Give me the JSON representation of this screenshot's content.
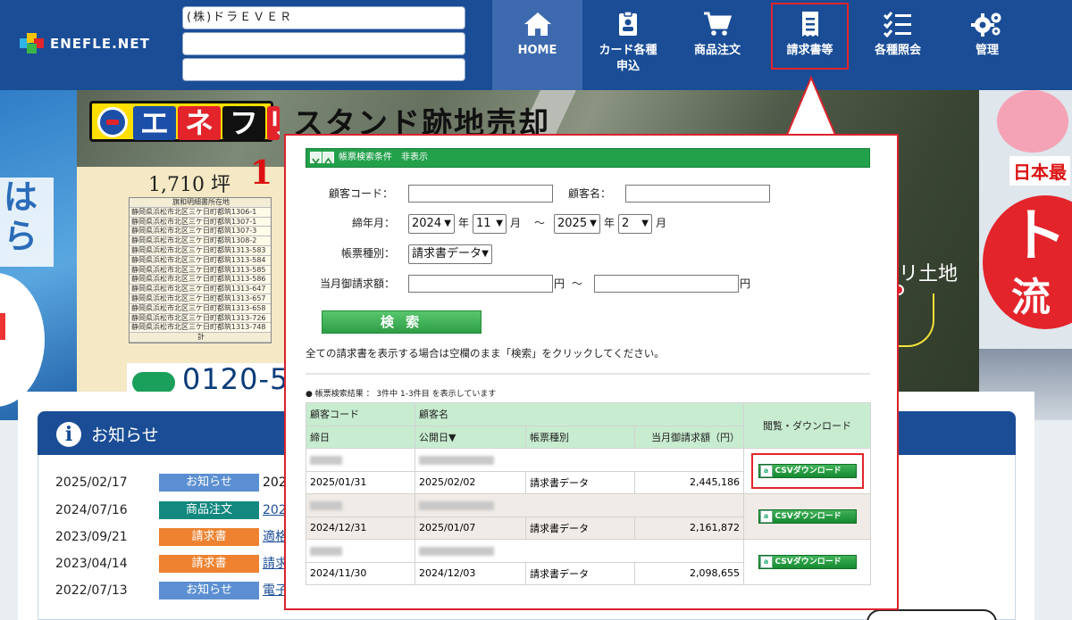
{
  "app": {
    "logo_text": "ENEFLE.NET",
    "account": {
      "company": "(株)ドラＥＶＥＲ",
      "line2": "",
      "line3": ""
    }
  },
  "nav": [
    {
      "label": "HOME",
      "icon": "home-icon",
      "active": true
    },
    {
      "label": "カード各種",
      "label2": "申込",
      "icon": "id-card-icon"
    },
    {
      "label": "商品注文",
      "icon": "cart-icon"
    },
    {
      "label": "請求書等",
      "icon": "invoice-icon",
      "highlighted": true
    },
    {
      "label": "各種照会",
      "icon": "checklist-icon"
    },
    {
      "label": "管理",
      "icon": "gears-icon"
    }
  ],
  "banner": {
    "sign_letters": [
      "エ",
      "ネ",
      "フ",
      "リ"
    ],
    "headline": "スタンド跡地売却",
    "area": "1,710 坪",
    "area_red": "1",
    "lot_header": "旗和明細書所在地",
    "lots": [
      "静岡県浜松市北区三ケ日町都筑1306-1",
      "静岡県浜松市北区三ケ日町都筑1307-1",
      "静岡県浜松市北区三ケ日町都筑1307-3",
      "静岡県浜松市北区三ケ日町都筑1308-2",
      "静岡県浜松市北区三ケ日町都筑1313-583",
      "静岡県浜松市北区三ケ日町都筑1313-584",
      "静岡県浜松市北区三ケ日町都筑1313-585",
      "静岡県浜松市北区三ケ日町都筑1313-586",
      "静岡県浜松市北区三ケ日町都筑1313-647",
      "静岡県浜松市北区三ケ日町都筑1313-657",
      "静岡県浜松市北区三ケ日町都筑1313-658",
      "静岡県浜松市北区三ケ日町都筑1313-726",
      "静岡県浜松市北区三ケ日町都筑1313-748"
    ],
    "lot_total": "計",
    "phone_partial": "0120-5",
    "map_label": "リ土地",
    "left_text": [
      "は",
      "ら"
    ],
    "right_top": "日本最",
    "right_big": "ト",
    "right_mid": "流"
  },
  "popup": {
    "section_title": "帳票検索条件　非表示",
    "labels": {
      "customer_code": "顧客コード：",
      "customer_name": "顧客名：",
      "closing_month": "締年月：",
      "doc_type": "帳票種別：",
      "amount": "当月御請求額：",
      "year": "年",
      "month": "月",
      "tilde": "～",
      "yen": "円"
    },
    "values": {
      "customer_code": "",
      "customer_name": "",
      "from_year": "2024",
      "from_month": "11",
      "to_year": "2025",
      "to_month": "2",
      "doc_type": "請求書データ",
      "amount_from": "",
      "amount_to": ""
    },
    "search_button": "検 索",
    "note": "全ての請求書を表示する場合は空欄のまま「検索」をクリックしてください。",
    "result_info": "● 帳票検索結果 ： 3件中 1-3件目 を表示しています",
    "columns": {
      "customer_code": "顧客コード",
      "customer_name": "顧客名",
      "closing_date": "締日",
      "publish_date": "公開日▼",
      "doc_type": "帳票種別",
      "amount": "当月御請求額（円）",
      "download": "閲覧・ダウンロード"
    },
    "rows": [
      {
        "closing_date": "2025/01/31",
        "publish_date": "2025/02/02",
        "doc_type": "請求書データ",
        "amount": "2,445,186",
        "download_label": "CSVダウンロード",
        "highlighted": true
      },
      {
        "closing_date": "2024/12/31",
        "publish_date": "2025/01/07",
        "doc_type": "請求書データ",
        "amount": "2,161,872",
        "download_label": "CSVダウンロード"
      },
      {
        "closing_date": "2024/11/30",
        "publish_date": "2024/12/03",
        "doc_type": "請求書データ",
        "amount": "2,098,655",
        "download_label": "CSVダウンロード"
      }
    ]
  },
  "news": {
    "title": "お知らせ",
    "items": [
      {
        "date": "2025/02/17",
        "tag": "お知らせ",
        "tag_color": "#5b8fd1",
        "text": "202",
        "link": false
      },
      {
        "date": "2024/07/16",
        "tag": "商品注文",
        "tag_color": "#12887f",
        "text": "202",
        "link": true
      },
      {
        "date": "2023/09/21",
        "tag": "請求書",
        "tag_color": "#ee8230",
        "text": "適格",
        "link": true
      },
      {
        "date": "2023/04/14",
        "tag": "請求書",
        "tag_color": "#ee8230",
        "text": "請求",
        "link": true
      },
      {
        "date": "2022/07/13",
        "tag": "お知らせ",
        "tag_color": "#5b8fd1",
        "text": "電子",
        "link": true
      }
    ]
  },
  "colors": {
    "header": "#1a4d96",
    "highlight": "#e3242b",
    "green": "#22a04a",
    "table_header": "#c8ecd0"
  }
}
